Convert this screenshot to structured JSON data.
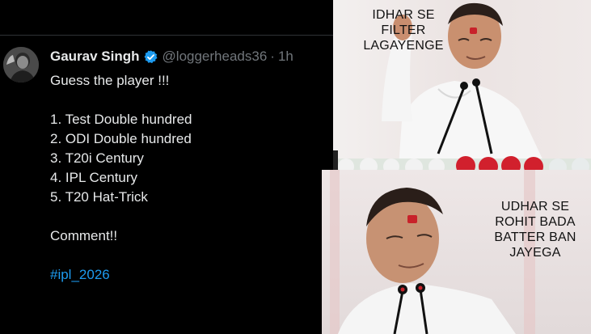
{
  "tweet": {
    "author_name": "Gaurav Singh",
    "handle": "@loggerheads36",
    "separator": "·",
    "time": "1h",
    "lines": [
      "Guess the player !!!",
      "",
      "1. Test Double hundred",
      "2. ODI Double hundred",
      "3. T20i Century",
      "4. IPL Century",
      "5. T20 Hat-Trick",
      "",
      "Comment!!",
      "",
      "#ipl_2026"
    ],
    "verified_icon": "verified-badge-icon",
    "colors": {
      "background": "#000000",
      "text": "#e7e9ea",
      "muted": "#71767b",
      "link": "#1d9bf0"
    }
  },
  "meme": {
    "top_caption_lines": [
      "IDHAR SE",
      "FILTER",
      "LAGAYENGE"
    ],
    "bottom_caption_lines": [
      "UDHAR SE",
      "ROHIT BADA",
      "BATTER BAN",
      "JAYEGA"
    ]
  }
}
